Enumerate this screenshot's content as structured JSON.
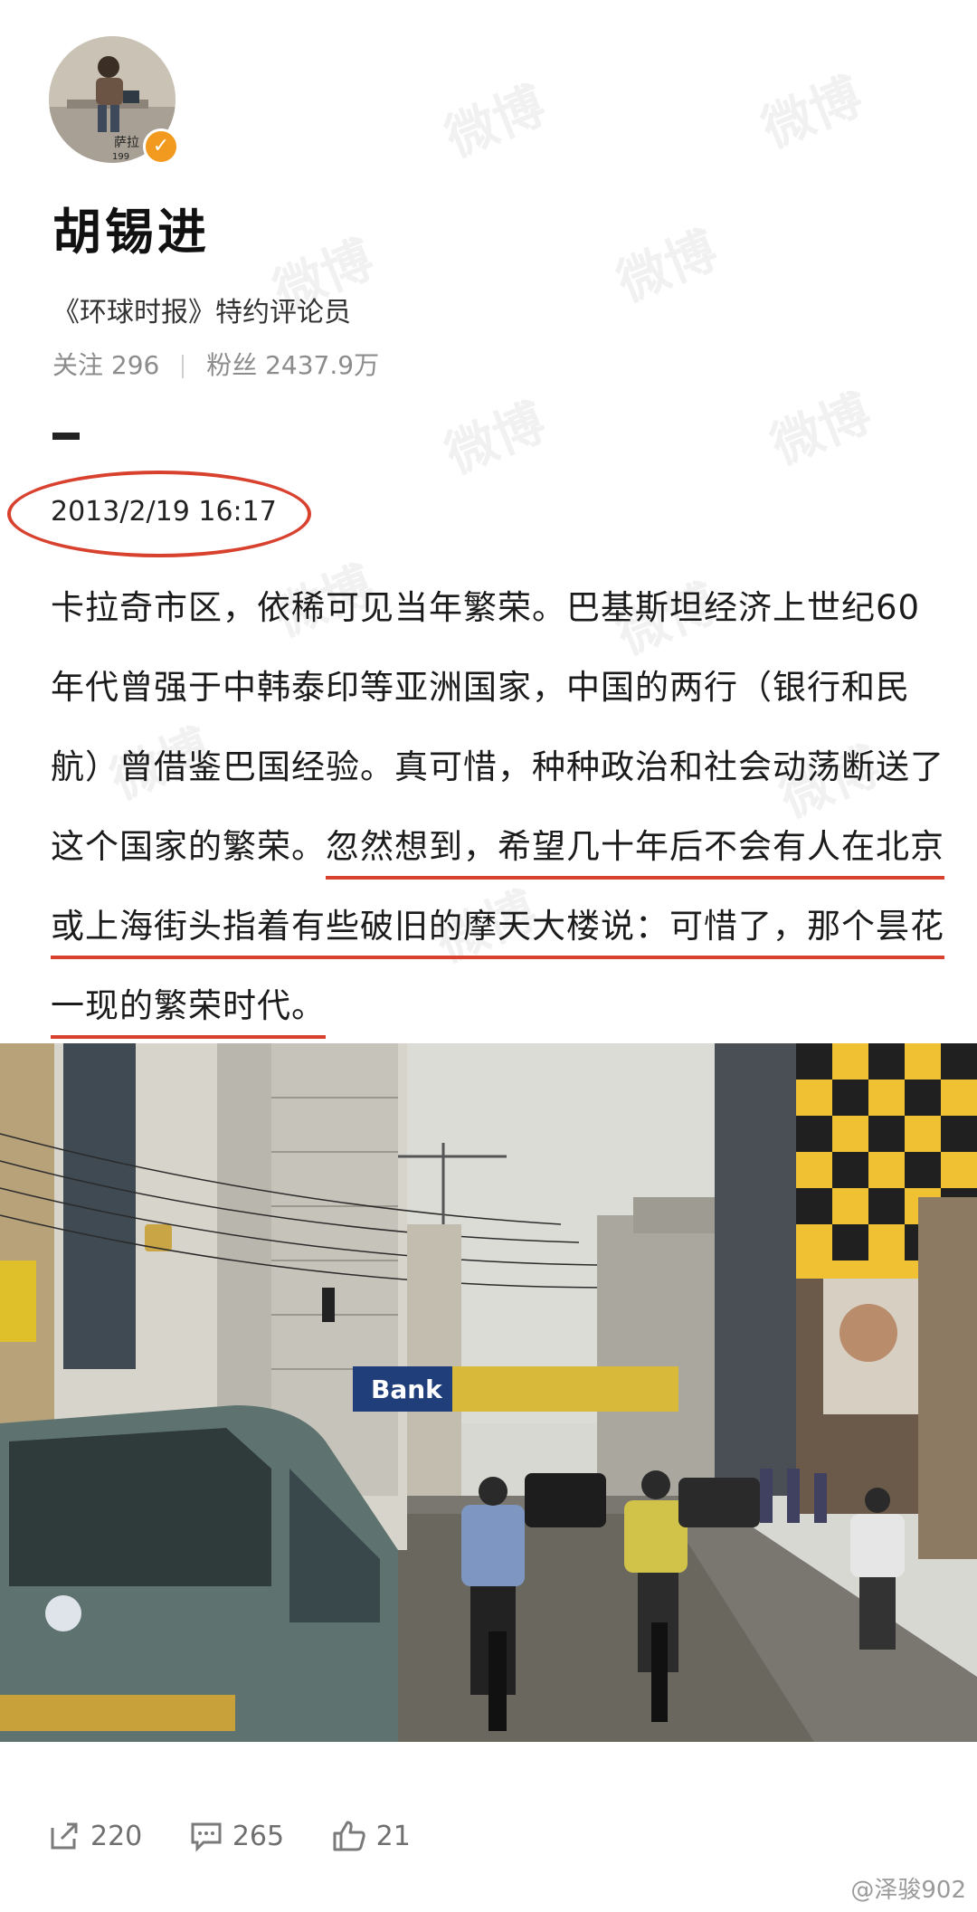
{
  "profile": {
    "name": "胡锡进",
    "bio": "《环球时报》特约评论员",
    "following_label": "关注",
    "following_count": "296",
    "followers_label": "粉丝",
    "followers_count": "2437.9万",
    "avatar_caption": "萨拉",
    "avatar_year": "199"
  },
  "post": {
    "date": "2013/2/19 16:17",
    "text_plain": "卡拉奇市区，依稀可见当年繁荣。巴基斯坦经济上世纪60年代曾强于中韩泰印等亚洲国家，中国的两行（银行和民航）曾借鉴巴国经验。真可惜，种种政治和社会动荡断送了这个国家的繁荣。",
    "text_highlight": "忽然想到，希望几十年后不会有人在北京或上海街头指着有些破旧的摩天大楼说：可惜了，那个昙花一现的繁荣时代。",
    "photo_banner": "Bank"
  },
  "actions": {
    "repost_count": "220",
    "comment_count": "265",
    "like_count": "21"
  },
  "watermark": {
    "text": "微博",
    "credit": "@泽骏902"
  },
  "colors": {
    "annotation_red": "#d9412f",
    "verified_orange": "#f29a1f"
  }
}
